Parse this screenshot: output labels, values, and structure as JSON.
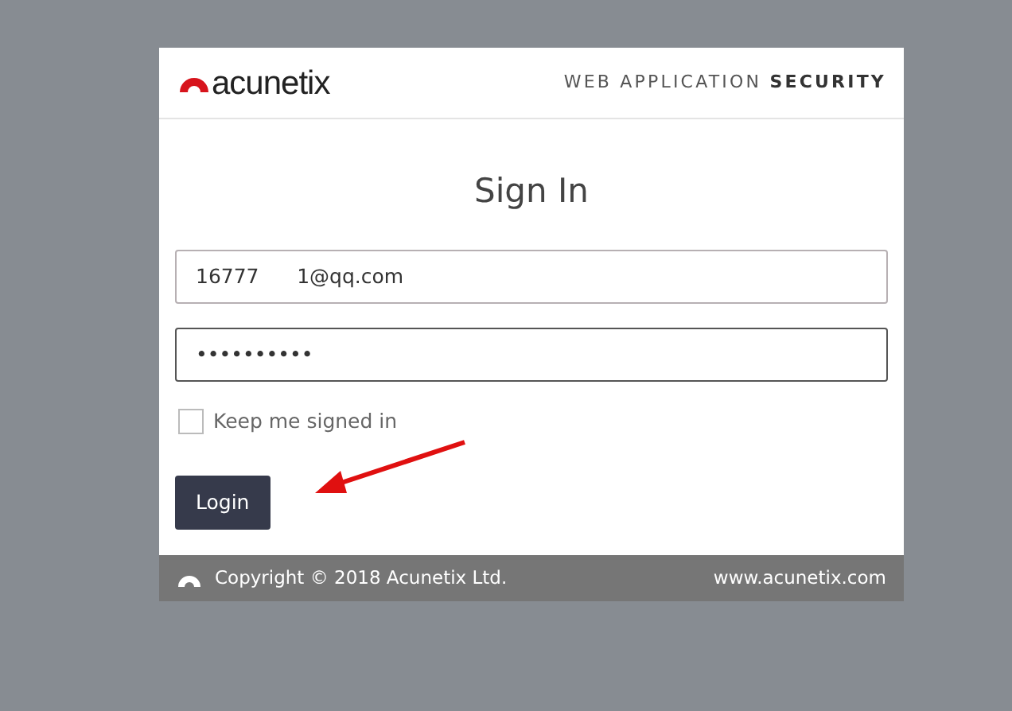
{
  "header": {
    "logo_text": "acunetix",
    "tagline_light": "WEB APPLICATION",
    "tagline_bold": "SECURITY"
  },
  "title": "Sign In",
  "email_field": {
    "value": "16777      1@qq.com"
  },
  "password_field": {
    "value": "••••••••••",
    "focused": true
  },
  "remember": {
    "label": "Keep me signed in",
    "checked": false
  },
  "login_button": "Login",
  "footer": {
    "copyright": "Copyright © 2018 Acunetix Ltd.",
    "website": "www.acunetix.com"
  }
}
